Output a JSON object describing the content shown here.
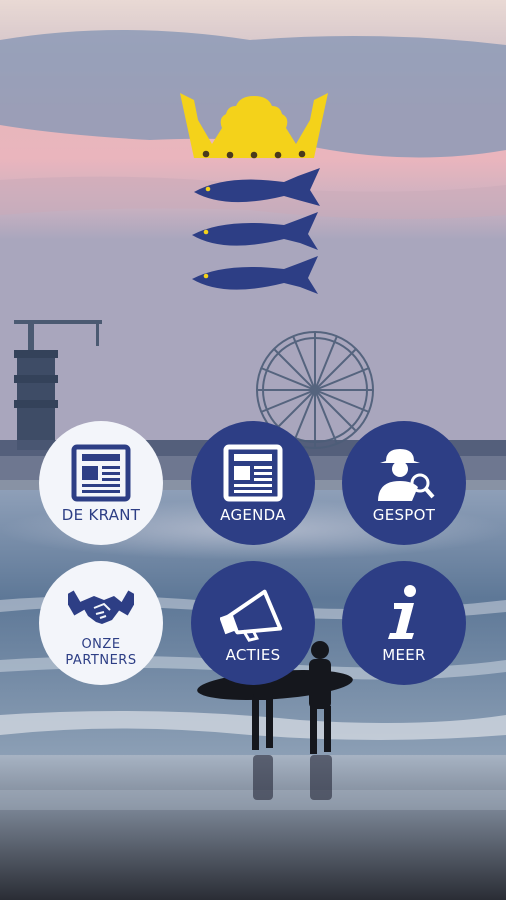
{
  "app": {
    "logo_icon": "crown-with-three-herrings-logo"
  },
  "menu": {
    "items": [
      {
        "id": "krant",
        "label": "DE KRANT",
        "icon": "newspaper-icon"
      },
      {
        "id": "agenda",
        "label": "AGENDA",
        "icon": "newspaper-icon"
      },
      {
        "id": "gespot",
        "label": "GESPOT",
        "icon": "detective-search-icon"
      },
      {
        "id": "partners",
        "label_line1": "ONZE",
        "label_line2": "PARTNERS",
        "icon": "handshake-icon"
      },
      {
        "id": "acties",
        "label": "ACTIES",
        "icon": "megaphone-icon"
      },
      {
        "id": "meer",
        "label": "MEER",
        "icon": "info-icon"
      }
    ]
  },
  "colors": {
    "brand_blue": "#2d3e85",
    "crown_yellow": "#f4d21a",
    "light_button": "#f3f5fa"
  }
}
